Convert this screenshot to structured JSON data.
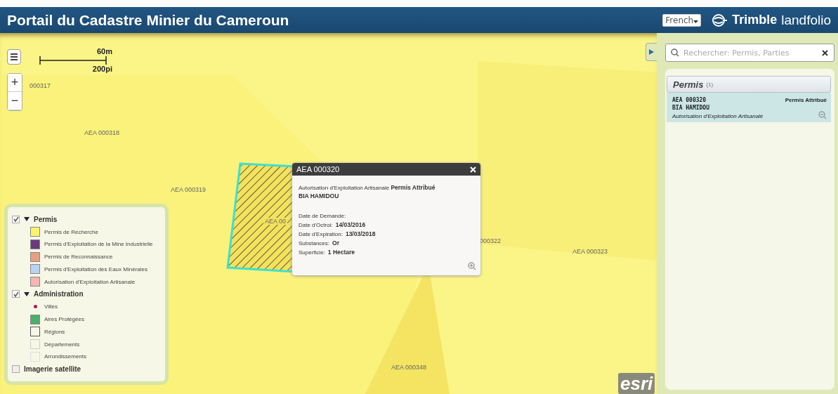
{
  "header": {
    "title": "Portail du Cadastre Minier du Cameroun",
    "language": "French",
    "brand": "Trimble",
    "product": "landfolio"
  },
  "map": {
    "scale": {
      "metric": "60m",
      "imperial": "200pi"
    },
    "zoom_in": "+",
    "zoom_out": "−",
    "attribution": "esri",
    "parcel_labels": [
      "000317",
      "AEA 000318",
      "AEA 000319",
      "AEA 00",
      "000322",
      "AEA 000323",
      "AEA 000348"
    ]
  },
  "legend": {
    "groups": [
      {
        "label": "Permis",
        "checked": true,
        "expanded": true,
        "items": [
          {
            "label": "Permis de Recherche",
            "kind": "swatch",
            "color": "#fff36a"
          },
          {
            "label": "Permis d'Exploitation de la Mine Industrielle",
            "kind": "swatch",
            "color": "#6a3a7e"
          },
          {
            "label": "Permis de Reconnaissance",
            "kind": "swatch",
            "color": "#e6a084"
          },
          {
            "label": "Permis d'Exploitation des Eaux Minérales",
            "kind": "swatch",
            "color": "#b9d3f3"
          },
          {
            "label": "Autorisation d'Exploitation Artisanale",
            "kind": "swatch",
            "color": "#f8b5b5"
          }
        ]
      },
      {
        "label": "Administration",
        "checked": true,
        "expanded": true,
        "items": [
          {
            "label": "Villes",
            "kind": "dot",
            "color": "#a0205a"
          },
          {
            "label": "Aires Protégées",
            "kind": "swatch",
            "color": "#4caf6a"
          },
          {
            "label": "Régions",
            "kind": "outline",
            "color": "#555555"
          },
          {
            "label": "Départements",
            "kind": "outline",
            "color": "#cccccc"
          },
          {
            "label": "Arrondissements",
            "kind": "outline",
            "color": "#dddddd"
          }
        ]
      }
    ],
    "layers": [
      {
        "label": "Imagerie satellite",
        "checked": false
      }
    ]
  },
  "popup": {
    "title": "AEA 000320",
    "type": "Autorisation d'Exploitation Artisanale",
    "status": "Permis Attribué",
    "holder": "BIA HAMIDOU",
    "fields": [
      {
        "label": "Date de Demande:"
      },
      {
        "label": "Date d'Octroi:",
        "value": "14/03/2016"
      },
      {
        "label": "Date d'Expiration:",
        "value": "13/03/2018"
      },
      {
        "label": "Substances:",
        "value": "Or"
      },
      {
        "label": "Superficie:",
        "value": "1 Hectare"
      }
    ]
  },
  "search": {
    "placeholder": "Rechercher: Permis, Parties"
  },
  "results": {
    "title": "Permis",
    "count": "(1)",
    "items": [
      {
        "id": "AEA 000320",
        "status": "Permis Attribué",
        "holder": "BIA HAMIDOU",
        "type": "Autorisation d'Exploitation Artisanale",
        "selected": true
      }
    ]
  }
}
